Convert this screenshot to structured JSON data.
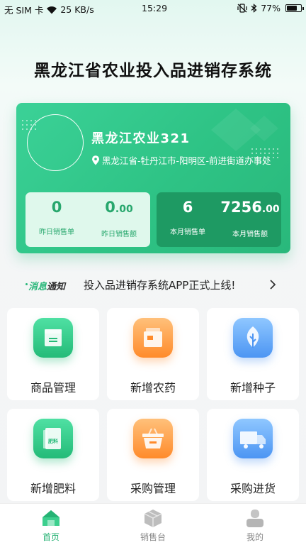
{
  "status_bar": {
    "left": "无 SIM 卡",
    "network_speed": "25 KB/s",
    "time": "15:29",
    "battery": "77%",
    "battery_level": 0.77,
    "icons": [
      "wifi-icon",
      "vibrate-icon",
      "bluetooth-icon",
      "battery-icon"
    ]
  },
  "app_title": "黑龙江省农业投入品进销存系统",
  "profile": {
    "name": "黑龙江农业321",
    "address": "黑龙江省-牡丹江市-阳明区-前进街道办事处"
  },
  "stats": {
    "yesterday_orders": {
      "value": "0",
      "label": "昨日销售单"
    },
    "yesterday_amount": {
      "value_int": "0",
      "value_dec": ".00",
      "label": "昨日销售额"
    },
    "month_orders": {
      "value": "6",
      "label": "本月销售单"
    },
    "month_amount": {
      "value_int": "7256",
      "value_dec": ".00",
      "label": "本月销售额"
    }
  },
  "notice": {
    "tag_prefix": "消息",
    "tag_suffix": "通知",
    "text": "投入品进销存系统APP正式上线!"
  },
  "grid": [
    {
      "label": "商品管理",
      "icon": "product-box-icon",
      "color": "#24bb78"
    },
    {
      "label": "新增农药",
      "icon": "pesticide-icon",
      "color": "#ff8b2b"
    },
    {
      "label": "新增种子",
      "icon": "seed-leaf-icon",
      "color": "#4c95f3"
    },
    {
      "label": "新增肥料",
      "icon": "fertilizer-bag-icon",
      "color": "#24bb78",
      "icon_text": "肥料"
    },
    {
      "label": "采购管理",
      "icon": "basket-icon",
      "color": "#ff8b2b"
    },
    {
      "label": "采购进货",
      "icon": "delivery-truck-icon",
      "color": "#4c95f3"
    }
  ],
  "bottom_nav": [
    {
      "label": "首页",
      "icon": "home-icon",
      "active": true
    },
    {
      "label": "销售台",
      "icon": "sales-cube-icon",
      "active": false
    },
    {
      "label": "我的",
      "icon": "user-profile-icon",
      "active": false
    }
  ],
  "colors": {
    "accent": "#2ec385",
    "accent_dark": "#1e9a63",
    "orange": "#ff8b2b",
    "blue": "#4c95f3"
  }
}
